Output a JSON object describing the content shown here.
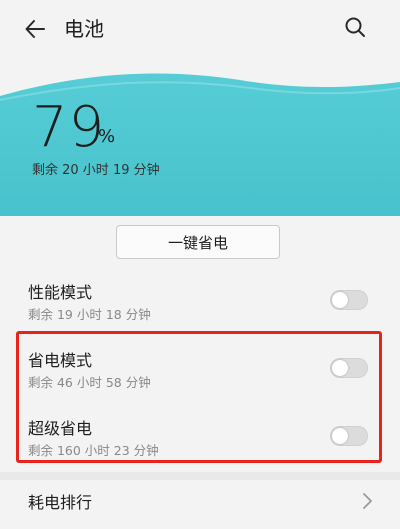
{
  "header": {
    "title": "电池",
    "back_icon": "arrow-left-icon",
    "search_icon": "search-icon"
  },
  "battery": {
    "percent": "79",
    "percent_unit": "%",
    "remaining": "剩余 20 小时 19 分钟"
  },
  "one_key": {
    "label": "一键省电"
  },
  "modes": [
    {
      "title": "性能模式",
      "subtitle": "剩余 19 小时 18 分钟",
      "enabled": false
    },
    {
      "title": "省电模式",
      "subtitle": "剩余 46 小时 58 分钟",
      "enabled": false
    },
    {
      "title": "超级省电",
      "subtitle": "剩余 160 小时 23 分钟",
      "enabled": false
    }
  ],
  "ranking": {
    "label": "耗电排行"
  },
  "colors": {
    "wave": "#4fc9d3",
    "highlight": "#e8231e"
  }
}
